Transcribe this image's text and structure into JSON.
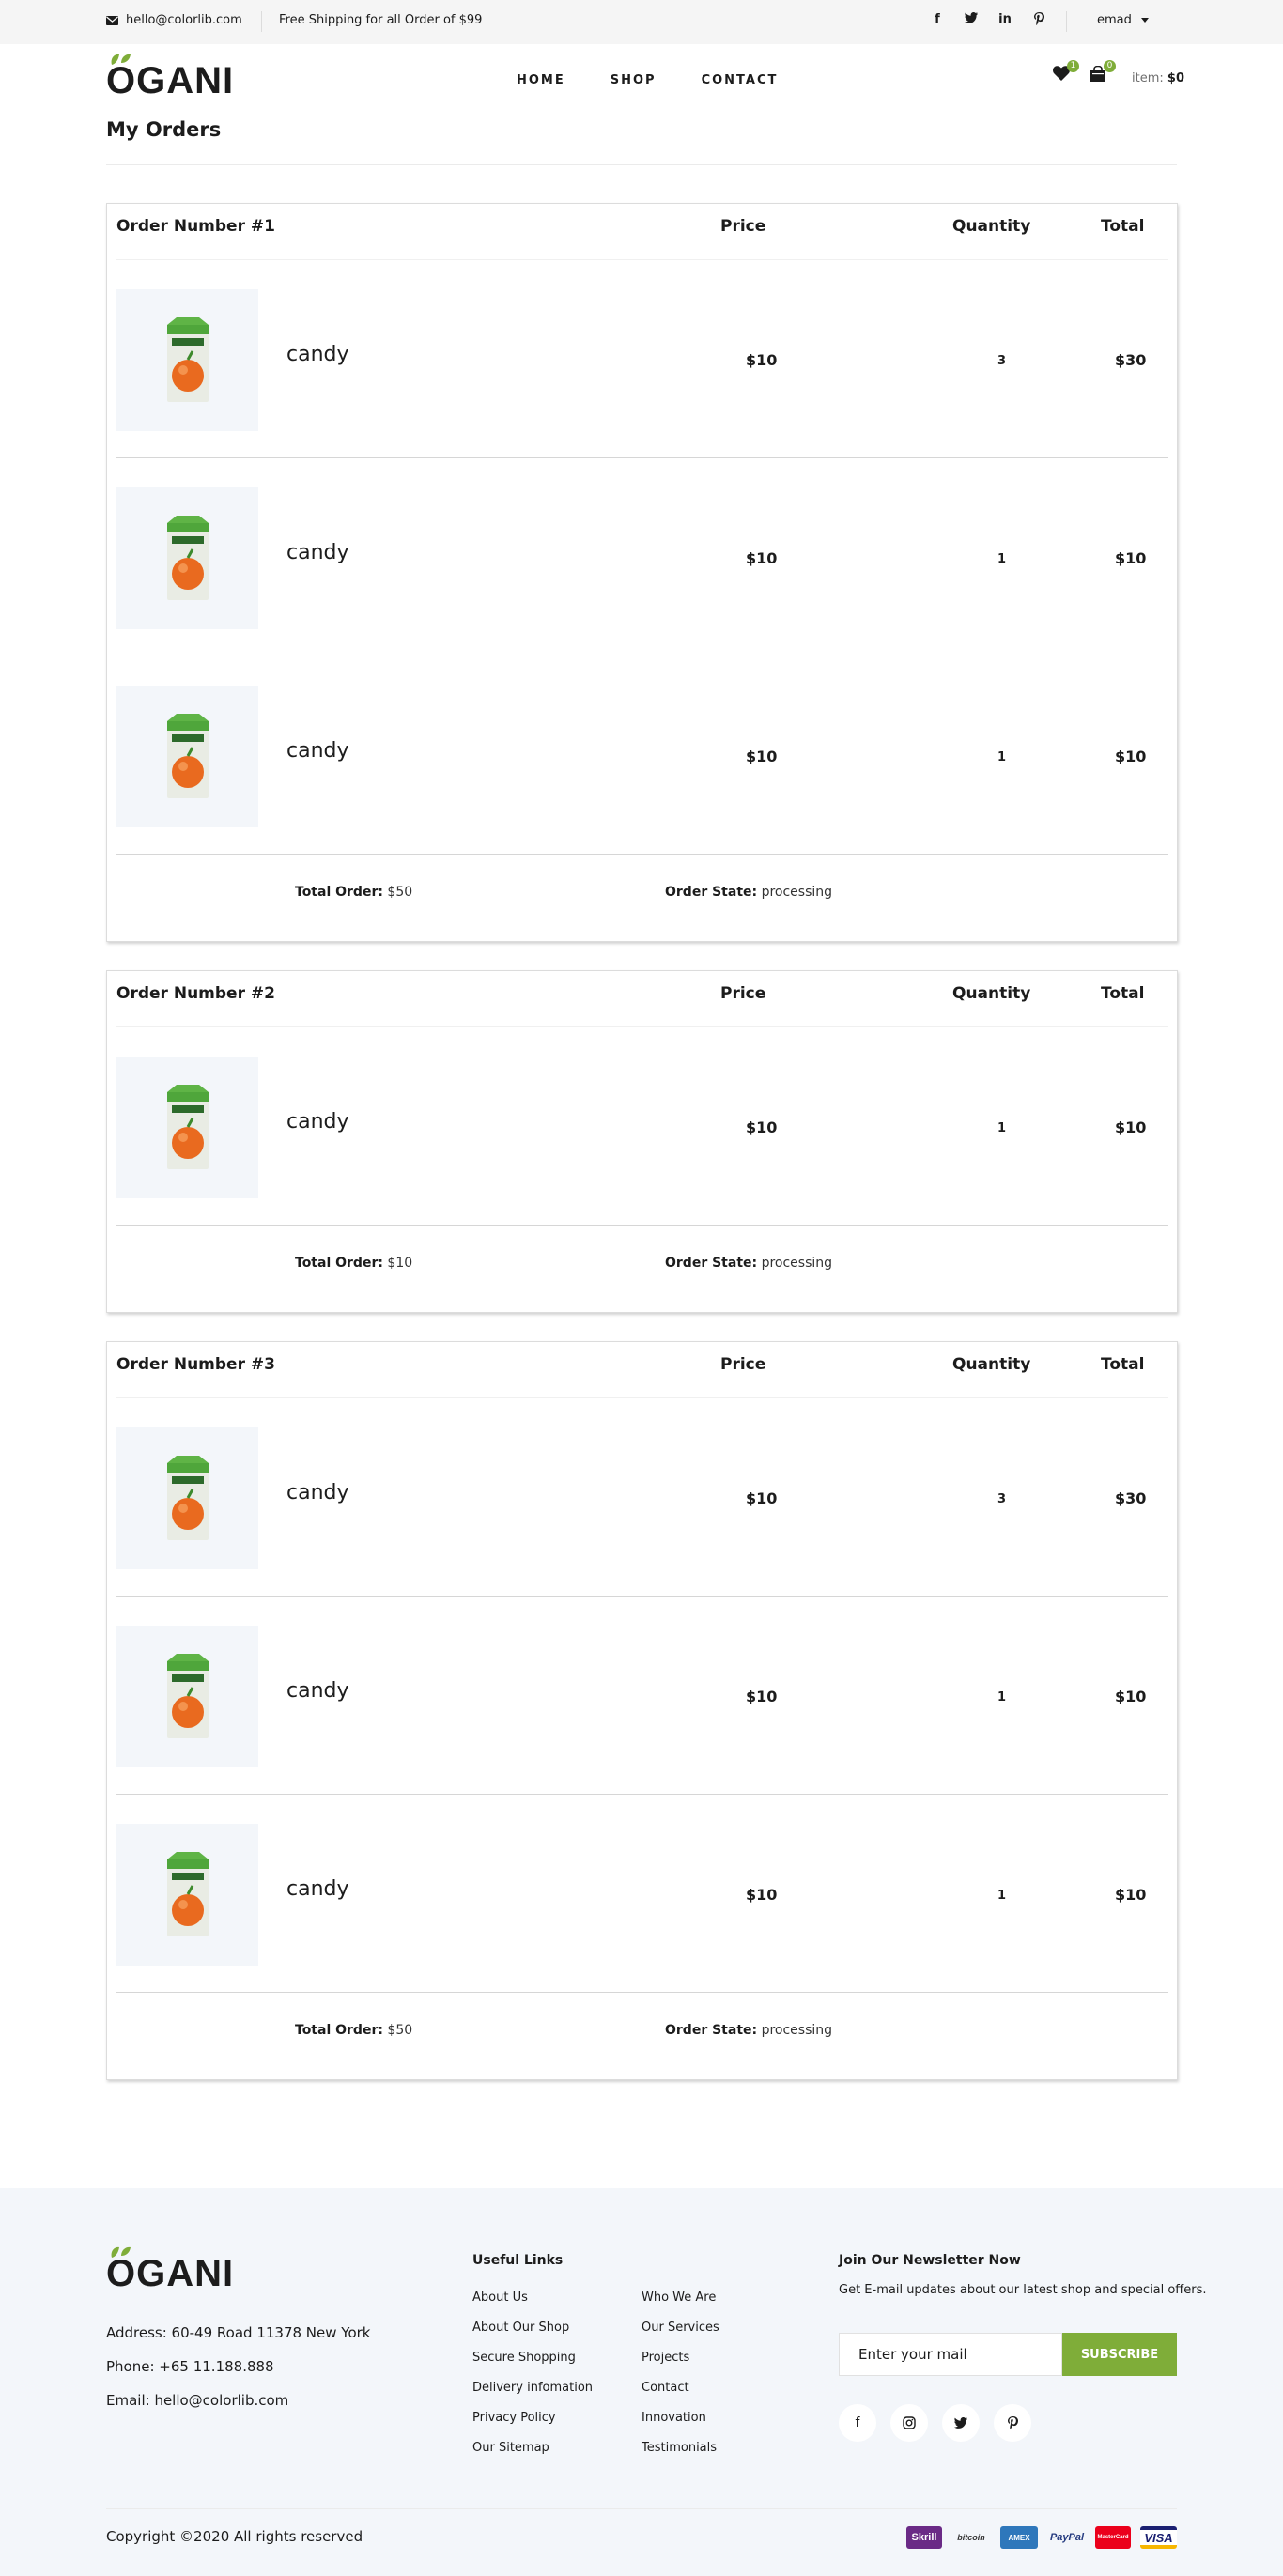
{
  "topbar": {
    "email": "hello@colorlib.com",
    "shipping": "Free Shipping for all Order of $99",
    "social_icons": [
      "facebook-icon",
      "twitter-icon",
      "linkedin-icon",
      "pinterest-icon"
    ],
    "user": "emad"
  },
  "header": {
    "logo": "OGANI",
    "nav": [
      "HOME",
      "SHOP",
      "CONTACT"
    ],
    "wishlist_count": "1",
    "cart_count": "0",
    "cart_label": "item:",
    "cart_amount": "$0"
  },
  "page": {
    "title": "My Orders"
  },
  "columns": {
    "price": "Price",
    "quantity": "Quantity",
    "total": "Total"
  },
  "orders": [
    {
      "title": "Order Number #1",
      "items": [
        {
          "name": "candy",
          "price": "$10",
          "qty": "3",
          "total": "$30"
        },
        {
          "name": "candy",
          "price": "$10",
          "qty": "1",
          "total": "$10"
        },
        {
          "name": "candy",
          "price": "$10",
          "qty": "1",
          "total": "$10"
        }
      ],
      "total_label": "Total Order:",
      "total_value": "$50",
      "state_label": "Order State:",
      "state_value": "processing"
    },
    {
      "title": "Order Number #2",
      "items": [
        {
          "name": "candy",
          "price": "$10",
          "qty": "1",
          "total": "$10"
        }
      ],
      "total_label": "Total Order:",
      "total_value": "$10",
      "state_label": "Order State:",
      "state_value": "processing"
    },
    {
      "title": "Order Number #3",
      "items": [
        {
          "name": "candy",
          "price": "$10",
          "qty": "3",
          "total": "$30"
        },
        {
          "name": "candy",
          "price": "$10",
          "qty": "1",
          "total": "$10"
        },
        {
          "name": "candy",
          "price": "$10",
          "qty": "1",
          "total": "$10"
        }
      ],
      "total_label": "Total Order:",
      "total_value": "$50",
      "state_label": "Order State:",
      "state_value": "processing"
    }
  ],
  "footer": {
    "logo": "OGANI",
    "address": "Address: 60-49 Road 11378 New York",
    "phone": "Phone: +65 11.188.888",
    "email": "Email: hello@colorlib.com",
    "links_title": "Useful Links",
    "links_col1": [
      "About Us",
      "About Our Shop",
      "Secure Shopping",
      "Delivery infomation",
      "Privacy Policy",
      "Our Sitemap"
    ],
    "links_col2": [
      "Who We Are",
      "Our Services",
      "Projects",
      "Contact",
      "Innovation",
      "Testimonials"
    ],
    "newsletter_title": "Join Our Newsletter Now",
    "newsletter_desc": "Get E-mail updates about our latest shop and special offers.",
    "newsletter_placeholder": "Enter your mail",
    "subscribe": "SUBSCRIBE",
    "social_icons": [
      "facebook-icon",
      "instagram-icon",
      "twitter-icon",
      "pinterest-icon"
    ],
    "copyright": "Copyright ©2020 All rights reserved",
    "payments": [
      "Skrill",
      "bitcoin",
      "AMEX",
      "PayPal",
      "MasterCard",
      "VISA"
    ]
  },
  "colors": {
    "accent": "#7fad39",
    "footer_bg": "#f3f6fa",
    "topbar_bg": "#f5f5f5"
  }
}
